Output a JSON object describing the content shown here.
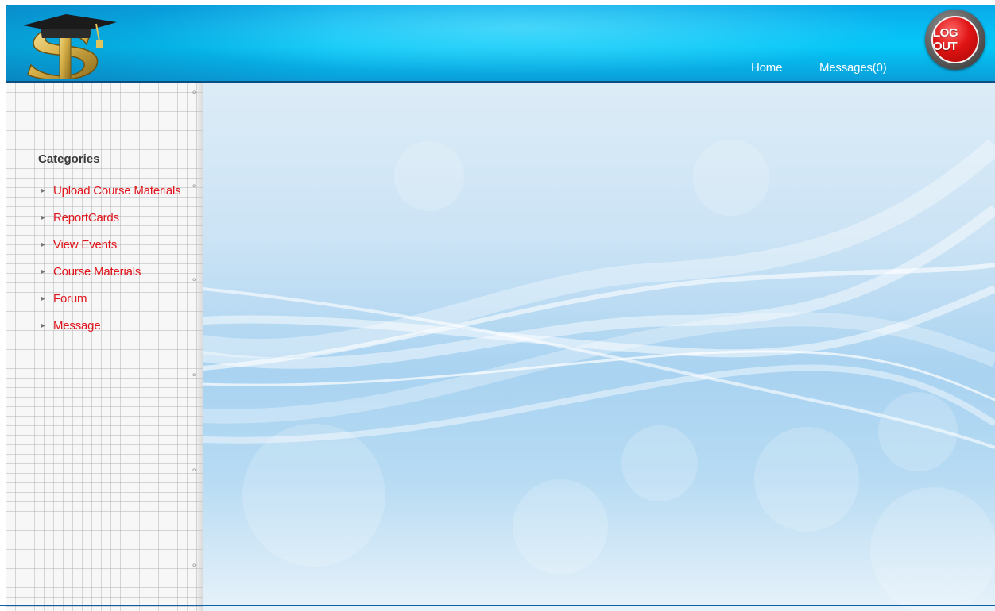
{
  "header": {
    "nav": {
      "home_label": "Home",
      "messages_label": "Messages(0)"
    },
    "logout_label": "LOG OUT"
  },
  "sidebar": {
    "title": "Categories",
    "items": [
      {
        "label": "Upload Course Materials"
      },
      {
        "label": "ReportCards"
      },
      {
        "label": "View Events"
      },
      {
        "label": "Course Materials"
      },
      {
        "label": "Forum"
      },
      {
        "label": "Message"
      }
    ]
  },
  "colors": {
    "header_blue": "#04c6f7",
    "link_red": "#e0141b",
    "logout_red": "#e01414"
  }
}
